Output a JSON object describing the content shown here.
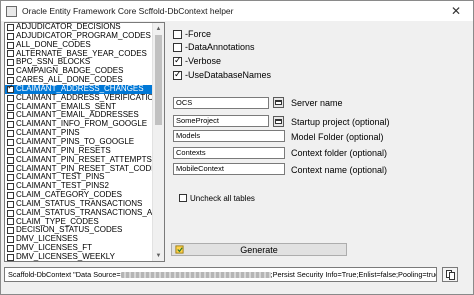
{
  "window": {
    "title": "Oracle Entity Framework Core Scffold-DbContext helper",
    "close_glyph": "✕"
  },
  "tables": [
    {
      "name": "ADJUDICATOR_DECISIONS",
      "checked": false,
      "selected": false
    },
    {
      "name": "ADJUDICATOR_PROGRAM_CODES",
      "checked": false,
      "selected": false
    },
    {
      "name": "ALL_DONE_CODES",
      "checked": false,
      "selected": false
    },
    {
      "name": "ALTERNATE_BASE_YEAR_CODES",
      "checked": false,
      "selected": false
    },
    {
      "name": "BPC_SSN_BLOCKS",
      "checked": false,
      "selected": false
    },
    {
      "name": "CAMPAIGN_BADGE_CODES",
      "checked": false,
      "selected": false
    },
    {
      "name": "CARES_ALL_DONE_CODES",
      "checked": false,
      "selected": false
    },
    {
      "name": "CLAIMANT_ADDRESS_CHANGES",
      "checked": true,
      "selected": true
    },
    {
      "name": "CLAIMANT_ADDRESS_VERIFICATIONS",
      "checked": false,
      "selected": false
    },
    {
      "name": "CLAIMANT_EMAILS_SENT",
      "checked": false,
      "selected": false
    },
    {
      "name": "CLAIMANT_EMAIL_ADDRESSES",
      "checked": false,
      "selected": false
    },
    {
      "name": "CLAIMANT_INFO_FROM_GOOGLE",
      "checked": false,
      "selected": false
    },
    {
      "name": "CLAIMANT_PINS",
      "checked": false,
      "selected": false
    },
    {
      "name": "CLAIMANT_PINS_TO_GOOGLE",
      "checked": false,
      "selected": false
    },
    {
      "name": "CLAIMANT_PIN_RESETS",
      "checked": false,
      "selected": false
    },
    {
      "name": "CLAIMANT_PIN_RESET_ATTEMPTS",
      "checked": false,
      "selected": false
    },
    {
      "name": "CLAIMANT_PIN_RESET_STAT_CODES",
      "checked": false,
      "selected": false
    },
    {
      "name": "CLAIMANT_TEST_PINS",
      "checked": false,
      "selected": false
    },
    {
      "name": "CLAIMANT_TEST_PINS2",
      "checked": false,
      "selected": false
    },
    {
      "name": "CLAIM_CATEGORY_CODES",
      "checked": false,
      "selected": false
    },
    {
      "name": "CLAIM_STATUS_TRANSACTIONS",
      "checked": false,
      "selected": false
    },
    {
      "name": "CLAIM_STATUS_TRANSACTIONS_ARCH",
      "checked": false,
      "selected": false
    },
    {
      "name": "CLAIM_TYPE_CODES",
      "checked": false,
      "selected": false
    },
    {
      "name": "DECISION_STATUS_CODES",
      "checked": false,
      "selected": false
    },
    {
      "name": "DMV_LICENSES",
      "checked": false,
      "selected": false
    },
    {
      "name": "DMV_LICENSES_FT",
      "checked": false,
      "selected": false
    },
    {
      "name": "DMV_LICENSES_WEEKLY",
      "checked": false,
      "selected": false
    }
  ],
  "options": {
    "force": {
      "label": "-Force",
      "checked": false
    },
    "data_annotations": {
      "label": "-DataAnnotations",
      "checked": false
    },
    "verbose": {
      "label": "-Verbose",
      "checked": true
    },
    "use_database_names": {
      "label": "-UseDatabaseNames",
      "checked": true
    }
  },
  "fields": {
    "server_name": {
      "value": "OCS",
      "label": "Server name"
    },
    "startup_project": {
      "value": "SomeProject",
      "label": "Startup project (optional)"
    },
    "model_folder": {
      "value": "Models",
      "label": "Model Folder (optional)"
    },
    "context_folder": {
      "value": "Contexts",
      "label": "Context folder (optional)"
    },
    "context_name": {
      "value": "MobileContext",
      "label": "Context name (optional)"
    }
  },
  "uncheck_all": {
    "label": "Uncheck all tables",
    "checked": false
  },
  "generate_button": {
    "label": "Generate"
  },
  "command": {
    "prefix": "Scaffold-DbContext \"Data Source=",
    "suffix": ";Persist Security Info=True;Enlist=false;Pooling=true;Stat"
  },
  "colors": {
    "selection": "#0078d7",
    "window_bg": "#f0f0f0"
  }
}
